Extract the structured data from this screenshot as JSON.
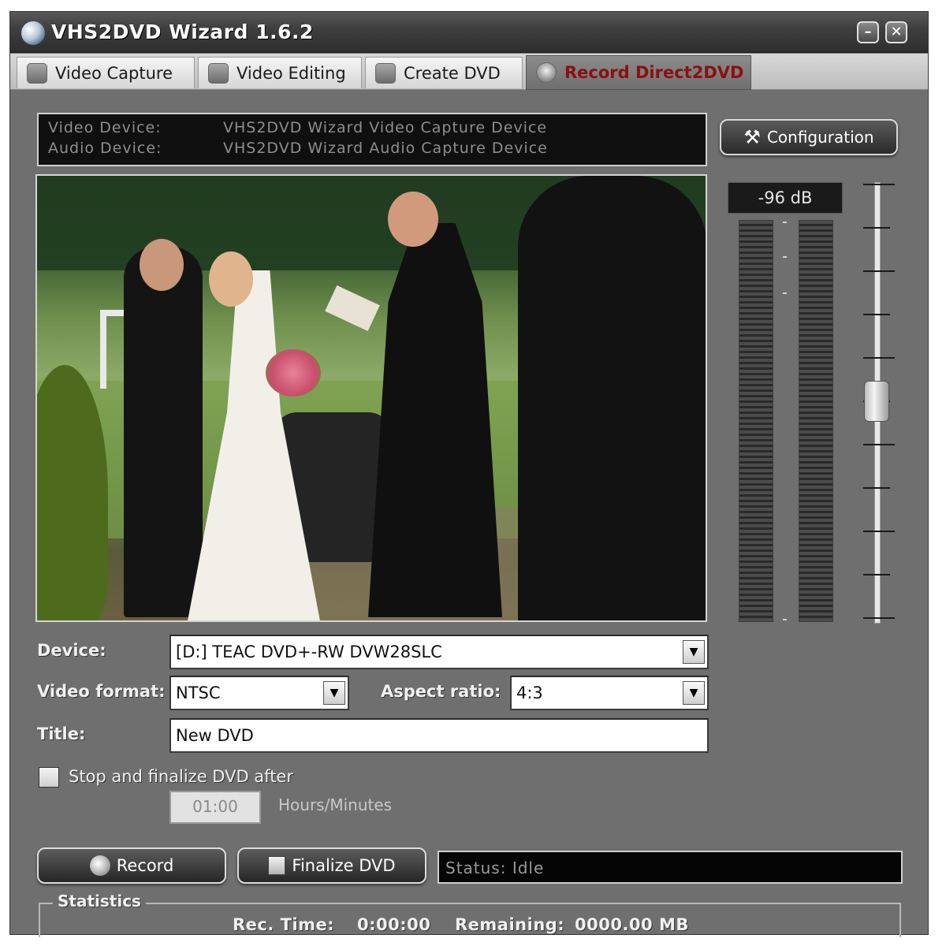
{
  "window": {
    "title": "VHS2DVD Wizard 1.6.2",
    "minimize_glyph": "–",
    "close_glyph": "✕"
  },
  "tabs": [
    {
      "label": "Video Capture",
      "icon": "video-capture-icon"
    },
    {
      "label": "Video Editing",
      "icon": "video-editing-icon"
    },
    {
      "label": "Create DVD",
      "icon": "dvd-disc-icon"
    },
    {
      "label": "Record Direct2DVD",
      "icon": "record-direct-icon",
      "active": true,
      "color": "#8b1010"
    }
  ],
  "device_info": {
    "video_label": "Video Device:",
    "video_value": "VHS2DVD Wizard Video Capture Device",
    "audio_label": "Audio Device:",
    "audio_value": "VHS2DVD Wizard Audio Capture Device"
  },
  "configuration": {
    "label": "Configuration",
    "icon_glyph": "⚒"
  },
  "audio": {
    "level_text": "-96 dB"
  },
  "form": {
    "device_label": "Device:",
    "device_value": "[D:] TEAC    DVD+-RW    DVW28SLC",
    "video_format_label": "Video format:",
    "video_format_value": "NTSC",
    "aspect_ratio_label": "Aspect ratio:",
    "aspect_ratio_value": "4:3",
    "title_label": "Title:",
    "title_value": "New DVD",
    "stop_finalize_label": "Stop and finalize DVD after",
    "stop_finalize_checked": false,
    "time_value": "01:00",
    "time_hint": "Hours/Minutes",
    "dropdown_glyph": "▼"
  },
  "controls": {
    "record_label": "Record",
    "finalize_label": "Finalize DVD",
    "status_text": "Status: Idle"
  },
  "statistics": {
    "legend": "Statistics",
    "rec_time_label": "Rec. Time:",
    "rec_time_value": "0:00:00",
    "remaining_label": "Remaining:",
    "remaining_value": "0000.00 MB"
  }
}
